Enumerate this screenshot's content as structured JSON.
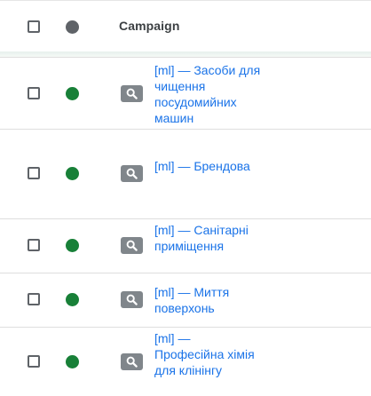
{
  "header": {
    "column_campaign_label": "Campaign"
  },
  "colors": {
    "status_enabled": "#188038",
    "status_header": "#5f6368",
    "link": "#1a73e8",
    "search_badge": "#80868b"
  },
  "rows": [
    {
      "status": "enabled",
      "type_icon": "search-icon",
      "campaign_name": "[ml] — Засоби для чищення посудомийних машин"
    },
    {
      "status": "enabled",
      "type_icon": "search-icon",
      "campaign_name": "[ml] — Брендова"
    },
    {
      "status": "enabled",
      "type_icon": "search-icon",
      "campaign_name": "[ml] — Санітарні приміщення"
    },
    {
      "status": "enabled",
      "type_icon": "search-icon",
      "campaign_name": "[ml] — Миття поверхонь"
    },
    {
      "status": "enabled",
      "type_icon": "search-icon",
      "campaign_name": "[ml] — Професійна хімія для клінінгу"
    }
  ]
}
